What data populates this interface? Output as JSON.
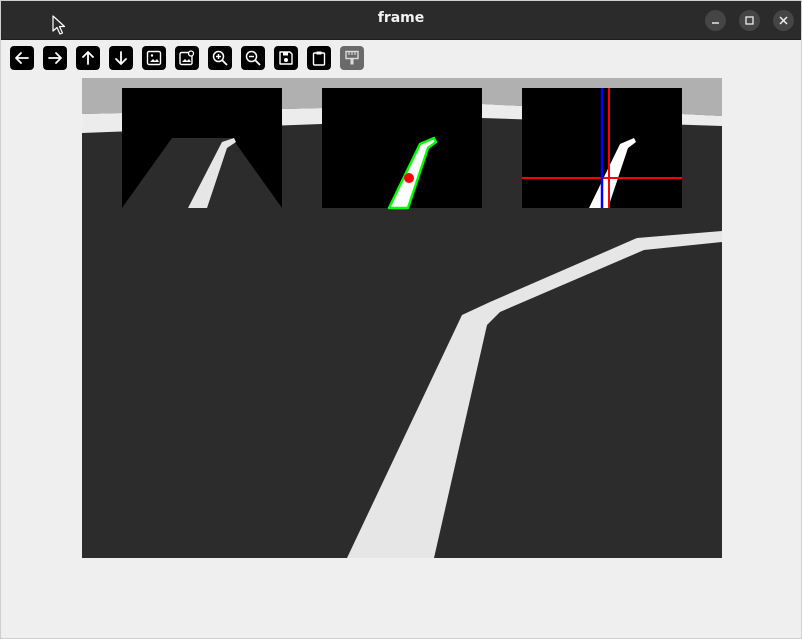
{
  "window": {
    "title": "frame"
  },
  "title_controls": [
    {
      "name": "minimize-button",
      "icon": "minimize-icon"
    },
    {
      "name": "maximize-button",
      "icon": "maximize-icon"
    },
    {
      "name": "close-button",
      "icon": "close-icon"
    }
  ],
  "toolbar": {
    "buttons": [
      {
        "name": "pan-left-button",
        "icon": "arrow-left-icon",
        "enabled": true
      },
      {
        "name": "pan-right-button",
        "icon": "arrow-right-icon",
        "enabled": true
      },
      {
        "name": "pan-up-button",
        "icon": "arrow-up-icon",
        "enabled": true
      },
      {
        "name": "pan-down-button",
        "icon": "arrow-down-icon",
        "enabled": true
      },
      {
        "name": "zoom-original-button",
        "icon": "image-icon",
        "enabled": true
      },
      {
        "name": "zoom-fit-button",
        "icon": "image-zoom-icon",
        "enabled": true
      },
      {
        "name": "zoom-in-button",
        "icon": "zoom-in-icon",
        "enabled": true
      },
      {
        "name": "zoom-out-button",
        "icon": "zoom-out-icon",
        "enabled": true
      },
      {
        "name": "save-image-button",
        "icon": "save-icon",
        "enabled": true
      },
      {
        "name": "copy-clipboard-button",
        "icon": "clipboard-icon",
        "enabled": true
      },
      {
        "name": "properties-button",
        "icon": "paint-brush-icon",
        "enabled": false
      }
    ]
  },
  "image_view": {
    "insets": [
      {
        "name": "inset-roi-view"
      },
      {
        "name": "inset-contour-view"
      },
      {
        "name": "inset-crosshair-view"
      }
    ],
    "colors": {
      "road": "#2c2c2c",
      "lane": "#e6e6e6",
      "wall": "#b0b0b0",
      "contour": "#00ff00",
      "centroid": "#ff0000",
      "crosshair_h": "#ff0000",
      "crosshair_v_red": "#ff0000",
      "crosshair_v_blue": "#0000ff"
    }
  }
}
